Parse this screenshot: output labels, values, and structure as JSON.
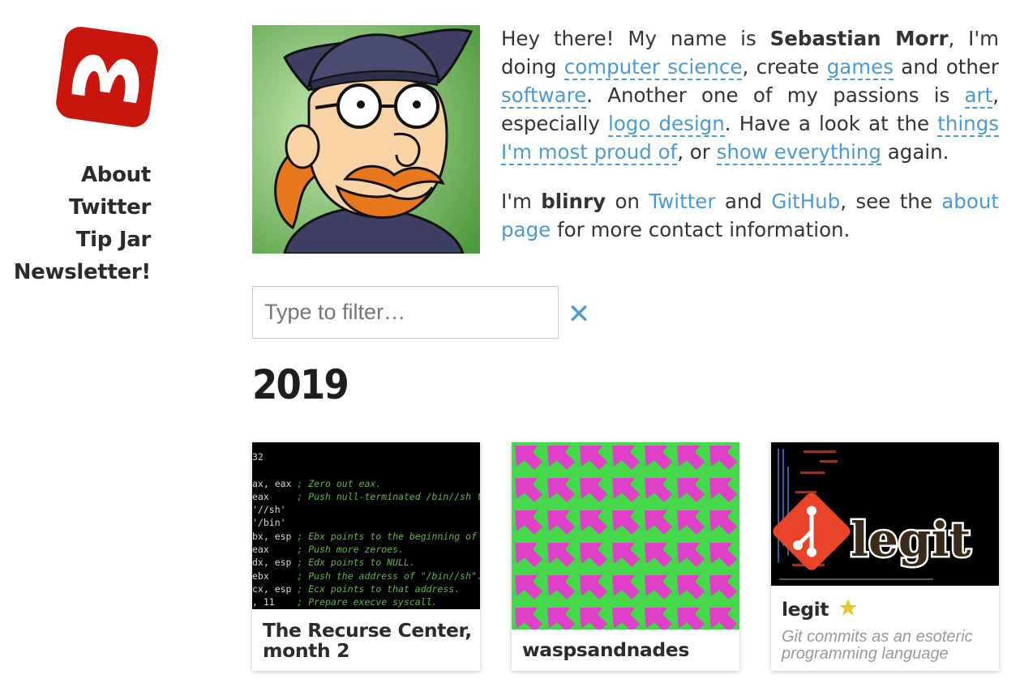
{
  "sidebar": {
    "nav": [
      "About",
      "Twitter",
      "Tip Jar",
      "Newsletter!"
    ],
    "logo_color": "#c8160e"
  },
  "intro": {
    "p1": {
      "t1": "Hey there! My name is ",
      "name": "Sebastian Morr",
      "t2": ", I'm doing ",
      "l_cs": "computer science",
      "t3": ", create ",
      "l_games": "games",
      "t4": " and other ",
      "l_software": "software",
      "t5": ". Another one of my passions is ",
      "l_art": "art",
      "t6": ", especially ",
      "l_logo": "logo design",
      "t7": ". Have a look at the ",
      "l_proud": "things I'm most proud of",
      "t8": ", or ",
      "l_show": "show everything",
      "t9": " again."
    },
    "p2": {
      "t1": "I'm ",
      "handle": "blinry",
      "t2": " on ",
      "l_twitter": "Twitter",
      "t3": " and ",
      "l_github": "GitHub",
      "t4": ", see the ",
      "l_about": "about page",
      "t5": " for more contact information."
    },
    "link_color": "#4a9ad6"
  },
  "filter": {
    "placeholder": "Type to filter…",
    "clear_glyph": "✕"
  },
  "year": "2019",
  "cards": [
    {
      "title": "The Recurse Center, month 2"
    },
    {
      "title": "waspsandnades"
    },
    {
      "title": "legit",
      "starred": true,
      "desc": "Git commits as an esoteric programming language",
      "logo_text": "legit"
    }
  ],
  "terminal": {
    "lines": [
      {
        "code": "32",
        "comment": ""
      },
      {
        "code": "",
        "comment": ""
      },
      {
        "code": "ax, eax",
        "comment": " ; Zero out eax."
      },
      {
        "code": "eax    ",
        "comment": " ; Push null-terminated /bin//sh to the"
      },
      {
        "code": "'//sh'",
        "comment": ""
      },
      {
        "code": "'/bin'",
        "comment": ""
      },
      {
        "code": "bx, esp",
        "comment": " ; Ebx points to the beginning of \"/bin/"
      },
      {
        "code": "eax    ",
        "comment": " ; Push more zeroes."
      },
      {
        "code": "dx, esp",
        "comment": " ; Edx points to NULL."
      },
      {
        "code": "ebx    ",
        "comment": " ; Push the address of \"/bin//sh\"."
      },
      {
        "code": "cx, esp",
        "comment": " ; Ecx points to that address."
      },
      {
        "code": ", 11   ",
        "comment": " ; Prepare execve syscall."
      }
    ]
  }
}
